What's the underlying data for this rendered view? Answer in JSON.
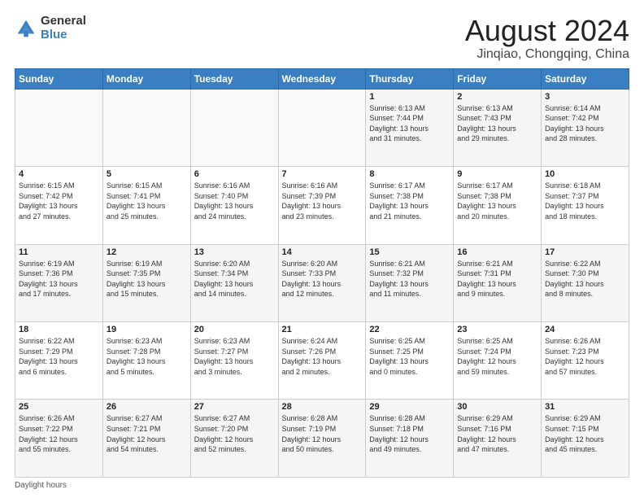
{
  "logo": {
    "general": "General",
    "blue": "Blue"
  },
  "header": {
    "title": "August 2024",
    "subtitle": "Jinqiao, Chongqing, China"
  },
  "days_of_week": [
    "Sunday",
    "Monday",
    "Tuesday",
    "Wednesday",
    "Thursday",
    "Friday",
    "Saturday"
  ],
  "weeks": [
    [
      {
        "day": "",
        "info": ""
      },
      {
        "day": "",
        "info": ""
      },
      {
        "day": "",
        "info": ""
      },
      {
        "day": "",
        "info": ""
      },
      {
        "day": "1",
        "info": "Sunrise: 6:13 AM\nSunset: 7:44 PM\nDaylight: 13 hours\nand 31 minutes."
      },
      {
        "day": "2",
        "info": "Sunrise: 6:13 AM\nSunset: 7:43 PM\nDaylight: 13 hours\nand 29 minutes."
      },
      {
        "day": "3",
        "info": "Sunrise: 6:14 AM\nSunset: 7:42 PM\nDaylight: 13 hours\nand 28 minutes."
      }
    ],
    [
      {
        "day": "4",
        "info": "Sunrise: 6:15 AM\nSunset: 7:42 PM\nDaylight: 13 hours\nand 27 minutes."
      },
      {
        "day": "5",
        "info": "Sunrise: 6:15 AM\nSunset: 7:41 PM\nDaylight: 13 hours\nand 25 minutes."
      },
      {
        "day": "6",
        "info": "Sunrise: 6:16 AM\nSunset: 7:40 PM\nDaylight: 13 hours\nand 24 minutes."
      },
      {
        "day": "7",
        "info": "Sunrise: 6:16 AM\nSunset: 7:39 PM\nDaylight: 13 hours\nand 23 minutes."
      },
      {
        "day": "8",
        "info": "Sunrise: 6:17 AM\nSunset: 7:38 PM\nDaylight: 13 hours\nand 21 minutes."
      },
      {
        "day": "9",
        "info": "Sunrise: 6:17 AM\nSunset: 7:38 PM\nDaylight: 13 hours\nand 20 minutes."
      },
      {
        "day": "10",
        "info": "Sunrise: 6:18 AM\nSunset: 7:37 PM\nDaylight: 13 hours\nand 18 minutes."
      }
    ],
    [
      {
        "day": "11",
        "info": "Sunrise: 6:19 AM\nSunset: 7:36 PM\nDaylight: 13 hours\nand 17 minutes."
      },
      {
        "day": "12",
        "info": "Sunrise: 6:19 AM\nSunset: 7:35 PM\nDaylight: 13 hours\nand 15 minutes."
      },
      {
        "day": "13",
        "info": "Sunrise: 6:20 AM\nSunset: 7:34 PM\nDaylight: 13 hours\nand 14 minutes."
      },
      {
        "day": "14",
        "info": "Sunrise: 6:20 AM\nSunset: 7:33 PM\nDaylight: 13 hours\nand 12 minutes."
      },
      {
        "day": "15",
        "info": "Sunrise: 6:21 AM\nSunset: 7:32 PM\nDaylight: 13 hours\nand 11 minutes."
      },
      {
        "day": "16",
        "info": "Sunrise: 6:21 AM\nSunset: 7:31 PM\nDaylight: 13 hours\nand 9 minutes."
      },
      {
        "day": "17",
        "info": "Sunrise: 6:22 AM\nSunset: 7:30 PM\nDaylight: 13 hours\nand 8 minutes."
      }
    ],
    [
      {
        "day": "18",
        "info": "Sunrise: 6:22 AM\nSunset: 7:29 PM\nDaylight: 13 hours\nand 6 minutes."
      },
      {
        "day": "19",
        "info": "Sunrise: 6:23 AM\nSunset: 7:28 PM\nDaylight: 13 hours\nand 5 minutes."
      },
      {
        "day": "20",
        "info": "Sunrise: 6:23 AM\nSunset: 7:27 PM\nDaylight: 13 hours\nand 3 minutes."
      },
      {
        "day": "21",
        "info": "Sunrise: 6:24 AM\nSunset: 7:26 PM\nDaylight: 13 hours\nand 2 minutes."
      },
      {
        "day": "22",
        "info": "Sunrise: 6:25 AM\nSunset: 7:25 PM\nDaylight: 13 hours\nand 0 minutes."
      },
      {
        "day": "23",
        "info": "Sunrise: 6:25 AM\nSunset: 7:24 PM\nDaylight: 12 hours\nand 59 minutes."
      },
      {
        "day": "24",
        "info": "Sunrise: 6:26 AM\nSunset: 7:23 PM\nDaylight: 12 hours\nand 57 minutes."
      }
    ],
    [
      {
        "day": "25",
        "info": "Sunrise: 6:26 AM\nSunset: 7:22 PM\nDaylight: 12 hours\nand 55 minutes."
      },
      {
        "day": "26",
        "info": "Sunrise: 6:27 AM\nSunset: 7:21 PM\nDaylight: 12 hours\nand 54 minutes."
      },
      {
        "day": "27",
        "info": "Sunrise: 6:27 AM\nSunset: 7:20 PM\nDaylight: 12 hours\nand 52 minutes."
      },
      {
        "day": "28",
        "info": "Sunrise: 6:28 AM\nSunset: 7:19 PM\nDaylight: 12 hours\nand 50 minutes."
      },
      {
        "day": "29",
        "info": "Sunrise: 6:28 AM\nSunset: 7:18 PM\nDaylight: 12 hours\nand 49 minutes."
      },
      {
        "day": "30",
        "info": "Sunrise: 6:29 AM\nSunset: 7:16 PM\nDaylight: 12 hours\nand 47 minutes."
      },
      {
        "day": "31",
        "info": "Sunrise: 6:29 AM\nSunset: 7:15 PM\nDaylight: 12 hours\nand 45 minutes."
      }
    ]
  ],
  "footer": {
    "note": "Daylight hours"
  },
  "colors": {
    "header_bg": "#3a7fc1",
    "header_text": "#ffffff",
    "border": "#cccccc"
  }
}
